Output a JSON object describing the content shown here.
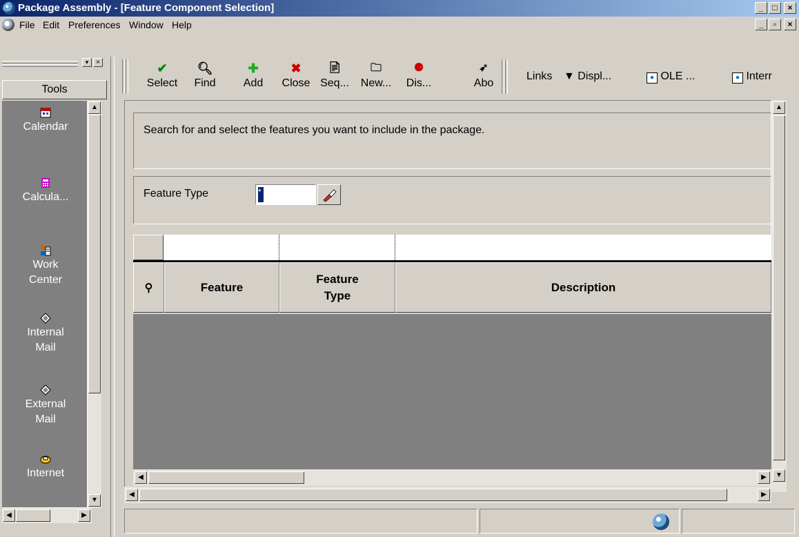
{
  "window": {
    "title": "Package Assembly - [Feature Component Selection]",
    "caption_buttons": [
      "_",
      "□",
      "×"
    ]
  },
  "menu": {
    "items": [
      "File",
      "Edit",
      "Preferences",
      "Window",
      "Help"
    ],
    "mdi_buttons": [
      "_",
      "▫",
      "×"
    ]
  },
  "tools": {
    "header": "Tools",
    "items": [
      {
        "label": "Calendar",
        "icon": "calendar-icon"
      },
      {
        "label": "Calcula...",
        "icon": "calculator-icon"
      },
      {
        "label_line1": "Work",
        "label_line2": "Center",
        "icon": "work-center-icon"
      },
      {
        "label_line1": "Internal",
        "label_line2": "Mail",
        "icon": "internal-mail-icon"
      },
      {
        "label_line1": "External",
        "label_line2": "Mail",
        "icon": "external-mail-icon"
      },
      {
        "label": "Internet",
        "icon": "internet-icon"
      }
    ]
  },
  "toolbar": {
    "select": "Select",
    "find": "Find",
    "add": "Add",
    "close": "Close",
    "seq": "Seq...",
    "new": "New...",
    "dis": "Dis...",
    "abo": "Abo",
    "links": "Links",
    "display": "Displ...",
    "ole": "OLE ...",
    "internet": "Interr"
  },
  "form": {
    "instruction": "Search for and select the features you want to include in the package.",
    "feature_type_label": "Feature Type",
    "feature_type_value": "*"
  },
  "grid": {
    "columns": [
      "Feature",
      "Feature Type",
      "Description"
    ]
  },
  "colors": {
    "title_gradient_start": "#0a246a",
    "title_gradient_end": "#a6caf0",
    "face": "#d4d0c8",
    "grid_bg": "#808080"
  }
}
